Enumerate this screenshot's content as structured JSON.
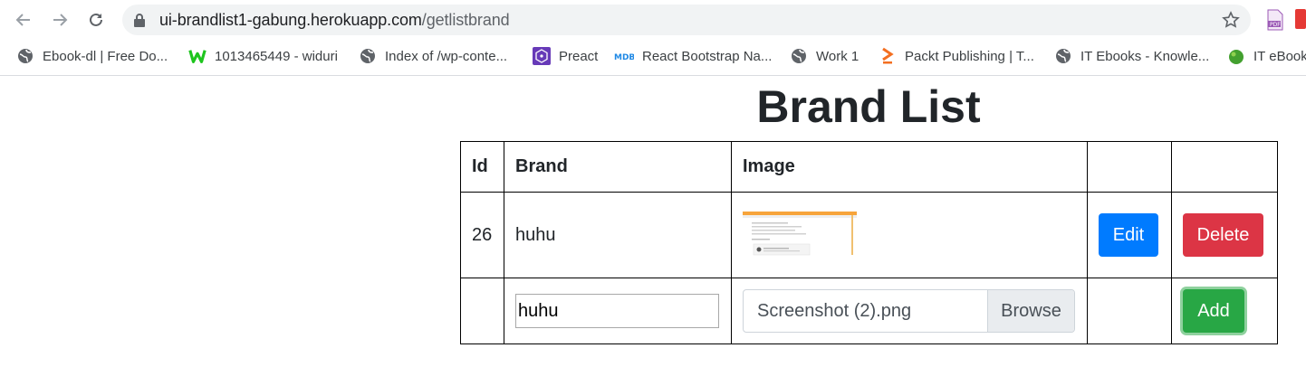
{
  "browser": {
    "url_host": "ui-brandlist1-gabung.herokuapp.com",
    "url_path": "/getlistbrand"
  },
  "bookmarks": [
    {
      "label": "Ebook-dl | Free Do...",
      "icon": "globe-icon"
    },
    {
      "label": "1013465449 - widuri",
      "icon": "wattpad-icon"
    },
    {
      "label": "Index of /wp-conte...",
      "icon": "globe-icon"
    },
    {
      "label": "Preact",
      "icon": "preact-icon"
    },
    {
      "label": "React Bootstrap Na...",
      "icon": "mdb-icon"
    },
    {
      "label": "Work 1",
      "icon": "globe-icon"
    },
    {
      "label": "Packt Publishing | T...",
      "icon": "packt-icon"
    },
    {
      "label": "IT Ebooks - Knowle...",
      "icon": "globe-icon"
    },
    {
      "label": "IT eBook",
      "icon": "green-ball-icon"
    }
  ],
  "page": {
    "title": "Brand List"
  },
  "table": {
    "headers": [
      "Id",
      "Brand",
      "Image",
      "",
      ""
    ],
    "rows": [
      {
        "id": "26",
        "brand": "huhu",
        "image_alt": "",
        "edit_label": "Edit",
        "delete_label": "Delete"
      }
    ],
    "form": {
      "brand_value": "huhu",
      "file_label": "Screenshot (2).png",
      "browse_label": "Browse",
      "add_label": "Add"
    }
  },
  "colors": {
    "edit": "#007bff",
    "delete": "#dc3545",
    "add": "#28a745"
  }
}
